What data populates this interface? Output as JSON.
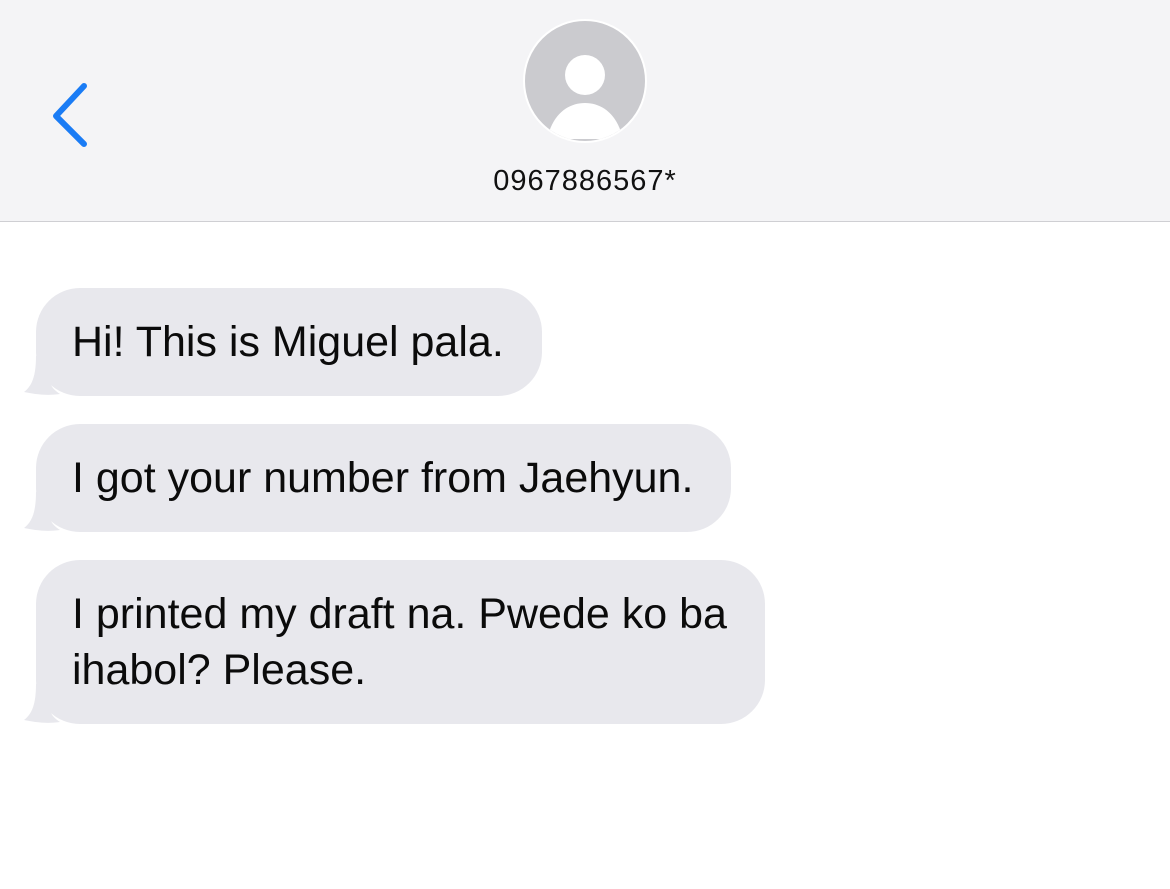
{
  "header": {
    "back_icon": "chevron-left-icon",
    "avatar_icon": "person-silhouette-icon",
    "contact_name": "0967886567*",
    "accent_color": "#1a7cf5"
  },
  "messages": [
    {
      "lines": [
        "Hi! This is Miguel pala."
      ]
    },
    {
      "lines": [
        "I got your number from Jaehyun."
      ]
    },
    {
      "lines": [
        "I printed my draft na. Pwede ko ba",
        "ihabol? Please."
      ]
    }
  ]
}
